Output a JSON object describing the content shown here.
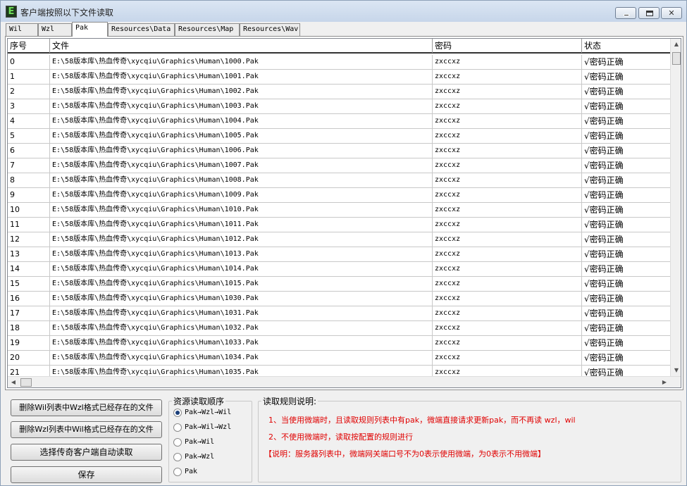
{
  "window": {
    "title": "客户端按照以下文件读取",
    "close_glyph": "✕"
  },
  "tabs": [
    "Wil",
    "Wzl",
    "Pak",
    "Resources\\Data",
    "Resources\\Map",
    "Resources\\Wav"
  ],
  "active_tab": "Pak",
  "table": {
    "columns": [
      "序号",
      "文件",
      "密码",
      "状态"
    ],
    "rows": [
      [
        "0",
        "E:\\58版本库\\热血传奇\\xycqiu\\Graphics\\Human\\1000.Pak",
        "zxccxz",
        "√密码正确"
      ],
      [
        "1",
        "E:\\58版本库\\热血传奇\\xycqiu\\Graphics\\Human\\1001.Pak",
        "zxccxz",
        "√密码正确"
      ],
      [
        "2",
        "E:\\58版本库\\热血传奇\\xycqiu\\Graphics\\Human\\1002.Pak",
        "zxccxz",
        "√密码正确"
      ],
      [
        "3",
        "E:\\58版本库\\热血传奇\\xycqiu\\Graphics\\Human\\1003.Pak",
        "zxccxz",
        "√密码正确"
      ],
      [
        "4",
        "E:\\58版本库\\热血传奇\\xycqiu\\Graphics\\Human\\1004.Pak",
        "zxccxz",
        "√密码正确"
      ],
      [
        "5",
        "E:\\58版本库\\热血传奇\\xycqiu\\Graphics\\Human\\1005.Pak",
        "zxccxz",
        "√密码正确"
      ],
      [
        "6",
        "E:\\58版本库\\热血传奇\\xycqiu\\Graphics\\Human\\1006.Pak",
        "zxccxz",
        "√密码正确"
      ],
      [
        "7",
        "E:\\58版本库\\热血传奇\\xycqiu\\Graphics\\Human\\1007.Pak",
        "zxccxz",
        "√密码正确"
      ],
      [
        "8",
        "E:\\58版本库\\热血传奇\\xycqiu\\Graphics\\Human\\1008.Pak",
        "zxccxz",
        "√密码正确"
      ],
      [
        "9",
        "E:\\58版本库\\热血传奇\\xycqiu\\Graphics\\Human\\1009.Pak",
        "zxccxz",
        "√密码正确"
      ],
      [
        "10",
        "E:\\58版本库\\热血传奇\\xycqiu\\Graphics\\Human\\1010.Pak",
        "zxccxz",
        "√密码正确"
      ],
      [
        "11",
        "E:\\58版本库\\热血传奇\\xycqiu\\Graphics\\Human\\1011.Pak",
        "zxccxz",
        "√密码正确"
      ],
      [
        "12",
        "E:\\58版本库\\热血传奇\\xycqiu\\Graphics\\Human\\1012.Pak",
        "zxccxz",
        "√密码正确"
      ],
      [
        "13",
        "E:\\58版本库\\热血传奇\\xycqiu\\Graphics\\Human\\1013.Pak",
        "zxccxz",
        "√密码正确"
      ],
      [
        "14",
        "E:\\58版本库\\热血传奇\\xycqiu\\Graphics\\Human\\1014.Pak",
        "zxccxz",
        "√密码正确"
      ],
      [
        "15",
        "E:\\58版本库\\热血传奇\\xycqiu\\Graphics\\Human\\1015.Pak",
        "zxccxz",
        "√密码正确"
      ],
      [
        "16",
        "E:\\58版本库\\热血传奇\\xycqiu\\Graphics\\Human\\1030.Pak",
        "zxccxz",
        "√密码正确"
      ],
      [
        "17",
        "E:\\58版本库\\热血传奇\\xycqiu\\Graphics\\Human\\1031.Pak",
        "zxccxz",
        "√密码正确"
      ],
      [
        "18",
        "E:\\58版本库\\热血传奇\\xycqiu\\Graphics\\Human\\1032.Pak",
        "zxccxz",
        "√密码正确"
      ],
      [
        "19",
        "E:\\58版本库\\热血传奇\\xycqiu\\Graphics\\Human\\1033.Pak",
        "zxccxz",
        "√密码正确"
      ],
      [
        "20",
        "E:\\58版本库\\热血传奇\\xycqiu\\Graphics\\Human\\1034.Pak",
        "zxccxz",
        "√密码正确"
      ],
      [
        "21",
        "E:\\58版本库\\热血传奇\\xycqiu\\Graphics\\Human\\1035.Pak",
        "zxccxz",
        "√密码正确"
      ]
    ]
  },
  "buttons": {
    "delete_wil": "删除Wil列表中Wzl格式已经存在的文件",
    "delete_wzl": "删除Wzl列表中Wil格式已经存在的文件",
    "choose_client": "选择传奇客户端自动读取",
    "save": "保存"
  },
  "order_group": {
    "title": "资源读取顺序",
    "options": [
      "Pak→Wzl→Wil",
      "Pak→Wil→Wzl",
      "Pak→Wil",
      "Pak→Wzl",
      "Pak"
    ],
    "selected": "Pak→Wzl→Wil"
  },
  "rules_group": {
    "title": "读取规则说明:",
    "lines": [
      "1、当使用微端时，且读取规则列表中有pak，微端直接请求更新pak，而不再读 wzl，wil",
      "2、不使用微端时，读取按配置的规则进行",
      "【说明：服务器列表中，微端网关端口号不为0表示使用微端，为0表示不用微端】"
    ]
  },
  "colors": {
    "note_red": "#e00000",
    "radio_selected": "#1a3f7a"
  }
}
